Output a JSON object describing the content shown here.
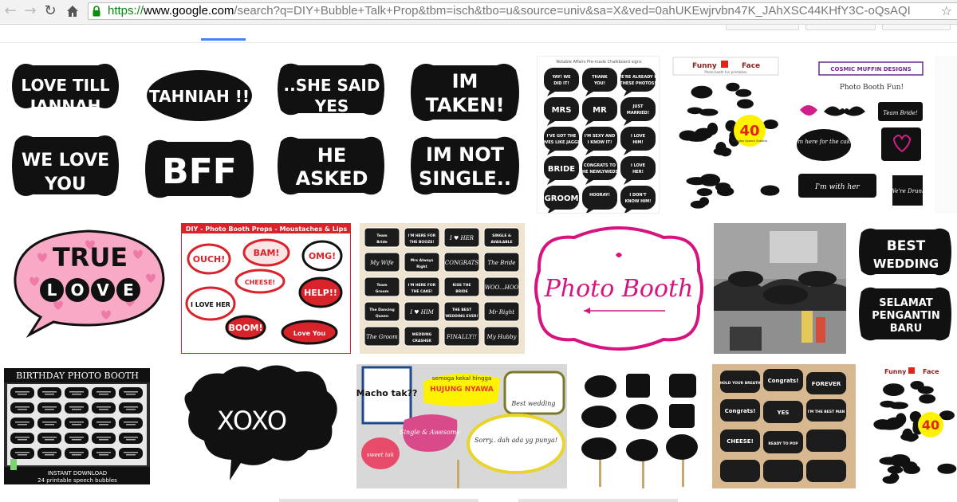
{
  "browser": {
    "url_scheme": "https://",
    "url_host": "www.google.com",
    "url_rest": "/search?q=DIY+Bubble+Talk+Prop&tbm=isch&tbo=u&source=univ&sa=X&ved=0ahUKEwjrvbn47K_JAhXSC44KHfY3C-oQsAQI",
    "icons": [
      "back-arrow-icon",
      "forward-arrow-icon",
      "reload-icon",
      "home-icon",
      "lock-icon",
      "bookmark-star-icon"
    ]
  },
  "results": {
    "row1": {
      "t1": [
        "LOVE TILL",
        "JANNAH",
        "WE LOVE",
        "YOU"
      ],
      "t2": [
        "TAHNIAH !!",
        "BFF"
      ],
      "t3": [
        "..SHE SAID",
        "YES",
        "HE",
        "ASKED"
      ],
      "t4": [
        "IM",
        "TAKEN!",
        "IM NOT",
        "SINGLE.."
      ],
      "t5": {
        "title": "Notable Affairs Pre-made Chalkboard signs",
        "signs": [
          "YAY! WE DID IT!",
          "THANK YOU!",
          "WE'RE ALREADY IN THESE PHOTOS!",
          "MRS",
          "MR",
          "JUST MARRIED!",
          "I'VE GOT THE MOVES LIKE JAGGER!",
          "I'M SEXY AND I KNOW IT!",
          "I LOVE HIM!",
          "BRIDE",
          "CONGRATS TO THE NEWLYWEDS!",
          "I LOVE HER!",
          "GROOM",
          "HOORAY!",
          "I DON'T KNOW HIM!"
        ]
      },
      "t6": {
        "brand1": "Funny",
        "brand2": "Face",
        "sub": "Photo booth fun printables",
        "num": "40",
        "num_sub": "Printable Speech Bubbles"
      },
      "t7": {
        "banner": "COSMIC MUFFIN DESIGNS",
        "title": "Photo Booth Fun!",
        "signs": [
          "Team Bride!",
          "I'm here for the cake",
          "I'm with her",
          "We're Drunk"
        ]
      }
    },
    "row2": {
      "t1": [
        "TRUE",
        "LOVE"
      ],
      "t2": {
        "title": "DIY - Photo Booth Props - Moustaches & Lips",
        "words": [
          "OUCH!",
          "BAM!",
          "OMG!",
          "CHEESE!",
          "I LOVE HER",
          "HELP!!",
          "BOOM!",
          "Love You"
        ]
      },
      "t3": [
        "Team Bride",
        "I'M HERE FOR THE BOOZE!",
        "I ♥ HER",
        "SINGLE & AVAILABLE",
        "My Wife",
        "Mrs Always Right",
        "CONGRATS",
        "The Bride",
        "Team Groom",
        "I'M HERE FOR THE CAKE!",
        "KISS THE BRIDE",
        "WOO...HOO",
        "The Dancing Queen",
        "I ♥ HIM",
        "THE BEST WEDDING EVER!",
        "Mr Right",
        "The Groom",
        "WEDDING CRASHER",
        "FINALLY!!",
        "My Hubby"
      ],
      "t4": "Photo Booth",
      "t6": [
        "BEST",
        "WEDDING",
        "SELAMAT",
        "PENGANTIN",
        "BARU"
      ]
    },
    "row3": {
      "t1": {
        "title": "BIRTHDAY PHOTO BOOTH",
        "footer1": "INSTANT DOWNLOAD",
        "footer2": "24 printable speech bubbles"
      },
      "t2": "XOXO",
      "t3": [
        "Macho tak??",
        "semoga kekal hingga",
        "HUJUNG NYAWA",
        "Best wedding",
        "Single & Awesome",
        "Sorry.. dah ada yg punya!",
        "sweet tak"
      ],
      "t5": [
        "HOLD YOUR BREATH",
        "Congrats!",
        "FOREVER",
        "Congrats!",
        "YES",
        "I'M THE BEST MAN",
        "CHEESE!",
        "READY TO POP"
      ],
      "t6": {
        "brand1": "Funny",
        "brand2": "Face",
        "num": "40"
      }
    }
  },
  "colors": {
    "accent": "#4285f4",
    "url_green": "#0a8a0a",
    "pink_bubble": "#f7a9c6",
    "magenta": "#d6147e",
    "chalkboard": "#111111"
  }
}
